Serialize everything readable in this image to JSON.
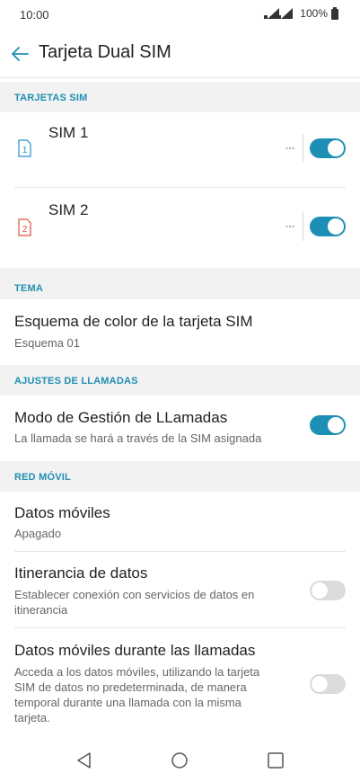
{
  "status_bar": {
    "time": "10:00",
    "battery": "100%"
  },
  "app_bar": {
    "title": "Tarjeta Dual SIM"
  },
  "sections": {
    "sim_cards": {
      "header": "TARJETAS SIM"
    },
    "theme": {
      "header": "TEMA"
    },
    "call_settings": {
      "header": "AJUSTES DE LLAMADAS"
    },
    "mobile_network": {
      "header": "RED MÓVIL"
    }
  },
  "sim1": {
    "label": "SIM 1",
    "icon_number": "1",
    "enabled": true
  },
  "sim2": {
    "label": "SIM 2",
    "icon_number": "2",
    "enabled": true
  },
  "color_scheme": {
    "title": "Esquema de color de la tarjeta SIM",
    "value": "Esquema 01"
  },
  "call_management": {
    "title": "Modo de Gestión de LLamadas",
    "subtitle": "La llamada se hará a través de la SIM asignada",
    "enabled": true
  },
  "mobile_data": {
    "title": "Datos móviles",
    "value": "Apagado"
  },
  "roaming": {
    "title": "Itinerancia de datos",
    "subtitle_line1": "Establecer conexión con servicios de datos en",
    "subtitle_line2": "itinerancia",
    "enabled": false
  },
  "data_during_calls": {
    "title": "Datos móviles durante las llamadas",
    "subtitle_line1": "Acceda a los datos móviles, utilizando la tarjeta",
    "subtitle_line2": "SIM de datos no predeterminada, de manera",
    "subtitle_line3": "temporal durante una llamada con la misma",
    "subtitle_line4": "tarjeta.",
    "enabled": false
  },
  "colors": {
    "accent": "#1d8fb4",
    "sim1_icon": "#2a8fd0",
    "sim2_icon": "#e0533d",
    "toggle_off": "#dcdcdc"
  }
}
